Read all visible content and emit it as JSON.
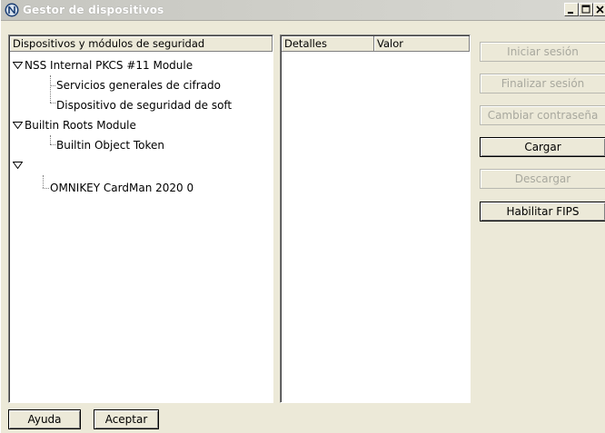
{
  "window": {
    "title": "Gestor de dispositivos"
  },
  "tree": {
    "header": "Dispositivos y módulos de seguridad",
    "modules": [
      {
        "name": "NSS Internal PKCS #11 Module",
        "expanded": true,
        "slots": [
          "Servicios generales de cifrado",
          "Dispositivo de seguridad de soft"
        ]
      },
      {
        "name": "Builtin Roots Module",
        "expanded": true,
        "slots": [
          "Builtin Object Token"
        ]
      },
      {
        "name": "",
        "expanded": true,
        "slots": [
          "OMNIKEY CardMan 2020 0"
        ]
      }
    ]
  },
  "details": {
    "col_details": "Detalles",
    "col_value": "Valor"
  },
  "actions": {
    "login": "Iniciar sesión",
    "logout": "Finalizar sesión",
    "change_password": "Cambiar contraseña",
    "load": "Cargar",
    "unload": "Descargar",
    "enable_fips": "Habilitar FIPS"
  },
  "footer": {
    "help": "Ayuda",
    "accept": "Aceptar"
  },
  "colors": {
    "face": "#ece9d8",
    "disabled_text": "#a8a89e"
  }
}
